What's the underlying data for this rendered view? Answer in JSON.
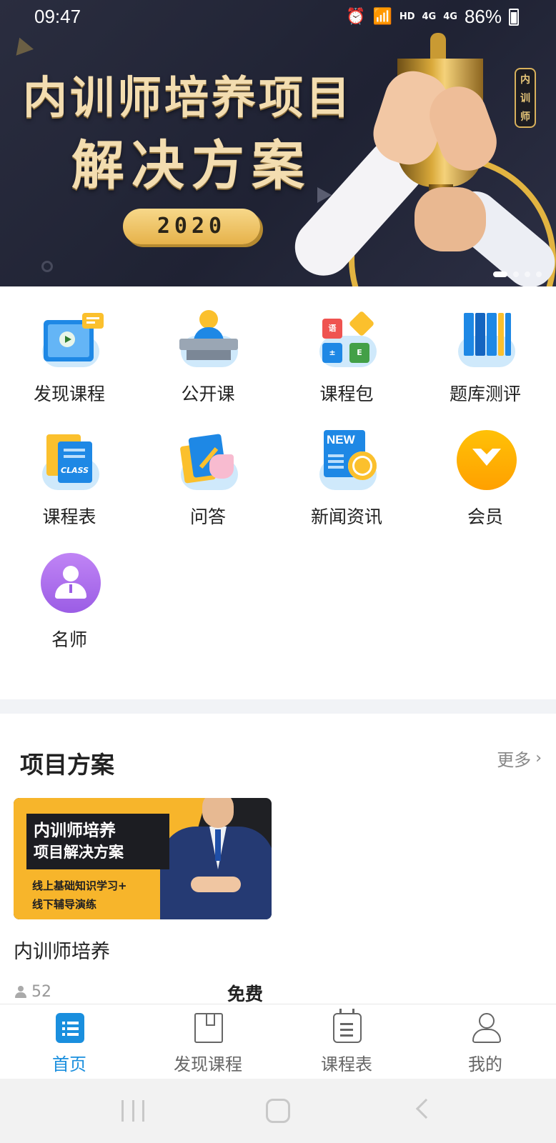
{
  "status_bar": {
    "time": "09:47",
    "hd": "HD",
    "net1": "4G",
    "net2": "4G",
    "battery": "86%"
  },
  "banner": {
    "title_line1": "内训师培养项目",
    "title_line2": "解决方案",
    "year": "2020",
    "badge": "内训师",
    "slides_total": 4,
    "slide_active": 1
  },
  "grid": {
    "items": [
      {
        "label": "发现课程",
        "icon": "video-course-icon"
      },
      {
        "label": "公开课",
        "icon": "lecturer-podium-icon"
      },
      {
        "label": "课程包",
        "icon": "course-package-icon"
      },
      {
        "label": "题库测评",
        "icon": "question-bank-icon"
      },
      {
        "label": "课程表",
        "icon": "class-schedule-icon"
      },
      {
        "label": "问答",
        "icon": "qa-icon"
      },
      {
        "label": "新闻资讯",
        "icon": "news-icon"
      },
      {
        "label": "会员",
        "icon": "member-icon"
      },
      {
        "label": "名师",
        "icon": "teacher-icon"
      }
    ],
    "schedule_icon_text": "CLASS",
    "news_icon_text": "NEW",
    "pack_badges": [
      "语",
      "",
      "±",
      "E"
    ]
  },
  "section": {
    "title": "项目方案",
    "more": "更多"
  },
  "card": {
    "image_line1": "内训师培养",
    "image_line2": "项目解决方案",
    "image_line3": "线上基础知识学习+",
    "image_line4": "线下辅导演练",
    "name": "内训师培养",
    "learners": "52",
    "price": "免费"
  },
  "tabbar": {
    "tabs": [
      {
        "label": "首页",
        "icon": "home-list-icon",
        "active": true
      },
      {
        "label": "发现课程",
        "icon": "book-icon",
        "active": false
      },
      {
        "label": "课程表",
        "icon": "calendar-icon",
        "active": false
      },
      {
        "label": "我的",
        "icon": "user-icon",
        "active": false
      }
    ],
    "active_color": "#1a8fde"
  },
  "colors": {
    "accent": "#1a8fde",
    "banner_bg": "#23263a",
    "gold": "#e6b24a"
  }
}
